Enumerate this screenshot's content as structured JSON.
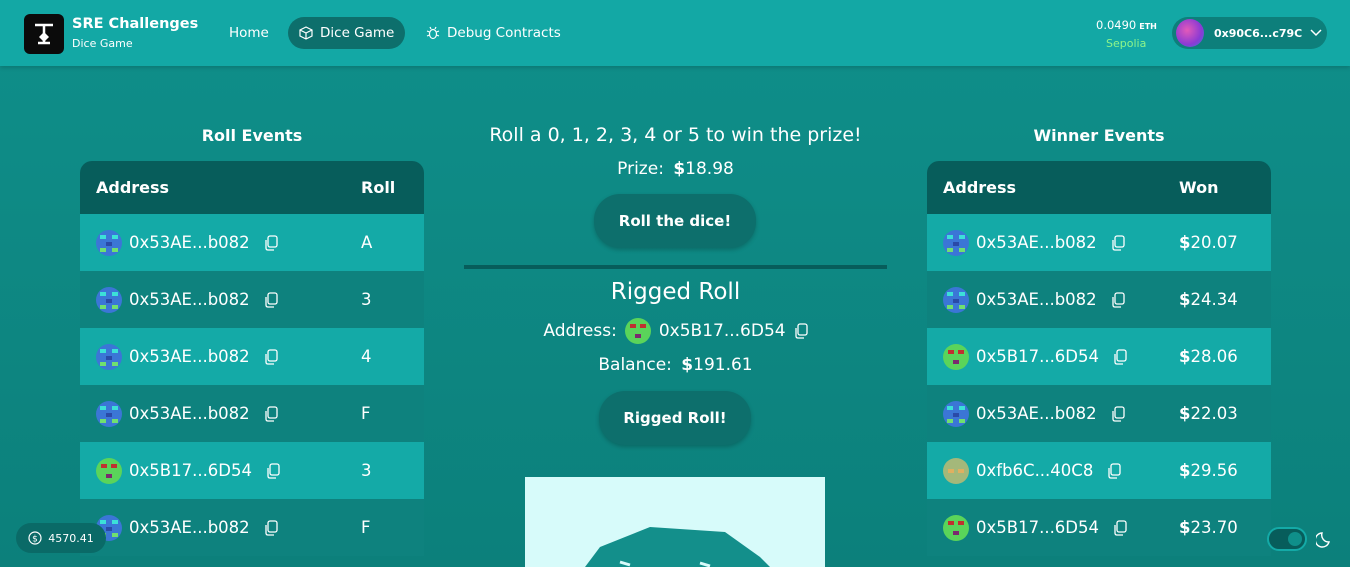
{
  "header": {
    "brand_title": "SRE Challenges",
    "brand_subtitle": "Dice Game",
    "nav": [
      {
        "label": "Home"
      },
      {
        "label": "Dice Game"
      },
      {
        "label": "Debug Contracts"
      }
    ],
    "balance": "0.0490",
    "balance_unit": "ETH",
    "network": "Sepolia",
    "account": "0x90C6...c79C"
  },
  "roll_events": {
    "title": "Roll Events",
    "col_address": "Address",
    "col_roll": "Roll",
    "rows": [
      {
        "address": "0x53AE...b082",
        "roll": "A",
        "avatar": "blue"
      },
      {
        "address": "0x53AE...b082",
        "roll": "3",
        "avatar": "blue"
      },
      {
        "address": "0x53AE...b082",
        "roll": "4",
        "avatar": "blue"
      },
      {
        "address": "0x53AE...b082",
        "roll": "F",
        "avatar": "blue"
      },
      {
        "address": "0x5B17...6D54",
        "roll": "3",
        "avatar": "green"
      },
      {
        "address": "0x53AE...b082",
        "roll": "F",
        "avatar": "blue"
      }
    ]
  },
  "winner_events": {
    "title": "Winner Events",
    "col_address": "Address",
    "col_won": "Won",
    "rows": [
      {
        "address": "0x53AE...b082",
        "won": "20.07",
        "avatar": "blue"
      },
      {
        "address": "0x53AE...b082",
        "won": "24.34",
        "avatar": "blue"
      },
      {
        "address": "0x5B17...6D54",
        "won": "28.06",
        "avatar": "green"
      },
      {
        "address": "0x53AE...b082",
        "won": "22.03",
        "avatar": "blue"
      },
      {
        "address": "0xfb6C...40C8",
        "won": "29.56",
        "avatar": "tan"
      },
      {
        "address": "0x5B17...6D54",
        "won": "23.70",
        "avatar": "green"
      }
    ]
  },
  "game": {
    "headline": "Roll a 0, 1, 2, 3, 4 or 5 to win the prize!",
    "prize_label": "Prize:",
    "prize_value": "18.98",
    "roll_button": "Roll the dice!",
    "rigged_title": "Rigged Roll",
    "address_label": "Address:",
    "rigged_address": "0x5B17...6D54",
    "balance_label": "Balance:",
    "rigged_balance": "191.61",
    "rigged_button": "Rigged Roll!"
  },
  "footer": {
    "wallet_value": "4570.41"
  },
  "colors": {
    "header": "#13a8a5",
    "background": "#0f8f8a",
    "table_head": "#075d5b",
    "row_light": "#14aaa7",
    "row_dark": "#0e827e",
    "network": "#8ff58a"
  }
}
